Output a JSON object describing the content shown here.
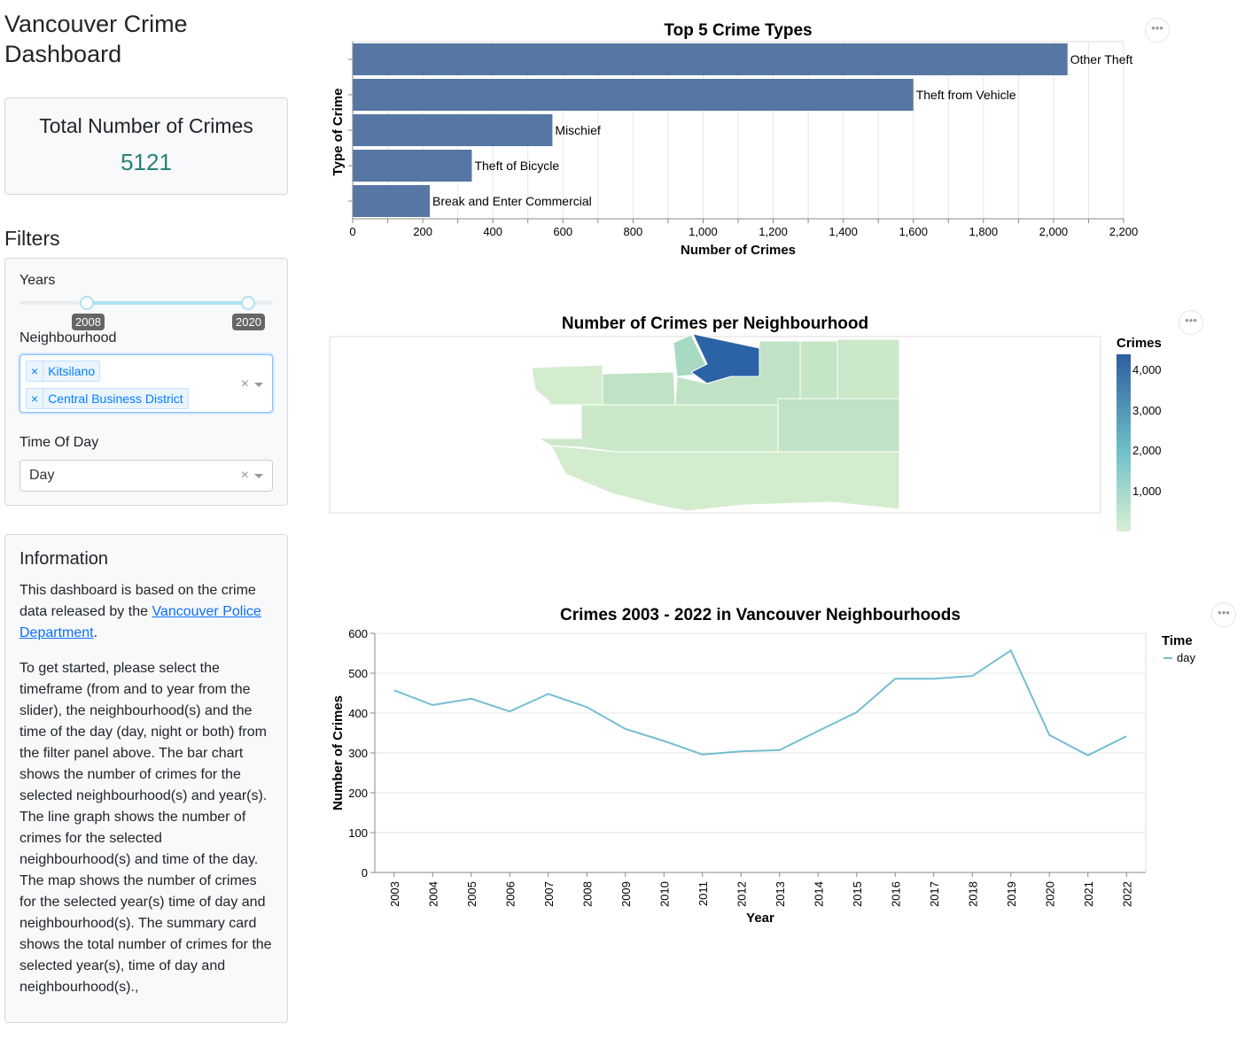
{
  "app": {
    "title_line1": "Vancouver Crime",
    "title_line2": "Dashboard"
  },
  "summary": {
    "title": "Total Number of Crimes",
    "value": "5121"
  },
  "filters": {
    "title": "Filters",
    "years_label": "Years",
    "year_from": "2008",
    "year_to": "2020",
    "neighbourhood_label": "Neighbourhood",
    "neighbourhoods_selected": [
      "Kitsilano",
      "Central Business District"
    ],
    "time_label": "Time Of Day",
    "time_value": "Day",
    "clear_glyph": "×",
    "chip_remove_glyph": "×"
  },
  "information": {
    "title": "Information",
    "p1_before": "This dashboard is based on the crime data released by the ",
    "p1_link": "Vancouver Police Department",
    "p1_after": ".",
    "p2": "To get started, please select the timeframe (from and to year from the slider), the neighbourhood(s) and the time of the day (day, night or both) from the filter panel above. The bar chart shows the number of crimes for the selected neighbourhood(s) and year(s). The line graph shows the number of crimes for the selected neighbourhood(s) and time of the day. The map shows the number of crimes for the selected year(s) time of day and neighbourhood(s). The summary card shows the total number of crimes for the selected year(s), time of day and neighbourhood(s).,"
  },
  "menu_glyph": "•••",
  "chart_data": [
    {
      "type": "bar",
      "title": "Top 5 Crime Types",
      "xlabel": "Number of Crimes",
      "ylabel": "Type of Crime",
      "categories": [
        "Other Theft",
        "Theft from Vehicle",
        "Mischief",
        "Theft of Bicycle",
        "Break and Enter Commercial"
      ],
      "values": [
        2040,
        1600,
        570,
        340,
        220
      ],
      "xlim": [
        0,
        2200
      ],
      "xticks": [
        "0",
        "200",
        "400",
        "600",
        "800",
        "1,000",
        "1,200",
        "1,400",
        "1,600",
        "1,800",
        "2,000",
        "2,200"
      ],
      "color": "#5677a4",
      "grid": true
    },
    {
      "type": "heatmap",
      "title": "Number of Crimes per Neighbourhood",
      "legend_title": "Crimes",
      "legend_ticks": [
        "4,000",
        "3,000",
        "2,000",
        "1,000"
      ],
      "color_low": "#d9f0d3",
      "color_high": "#2c5fa0",
      "regions": [
        {
          "value": 4300,
          "color": "#2c63a6"
        },
        {
          "value": 1300,
          "color": "#a8d9c2"
        },
        {
          "value": 900,
          "color": "#bfe3c4"
        },
        {
          "value": 850,
          "color": "#c4e5c6"
        },
        {
          "value": 700,
          "color": "#cbe8c8"
        },
        {
          "value": 600,
          "color": "#d4ecce"
        }
      ]
    },
    {
      "type": "line",
      "title": "Crimes 2003 - 2022 in Vancouver Neighbourhoods",
      "xlabel": "Year",
      "ylabel": "Number of Crimes",
      "ylim": [
        0,
        600
      ],
      "yticks": [
        "0",
        "100",
        "200",
        "300",
        "400",
        "500",
        "600"
      ],
      "x": [
        "2003",
        "2004",
        "2005",
        "2006",
        "2007",
        "2008",
        "2009",
        "2010",
        "2011",
        "2012",
        "2013",
        "2014",
        "2015",
        "2016",
        "2017",
        "2018",
        "2019",
        "2020",
        "2021",
        "2022"
      ],
      "series": [
        {
          "name": "day",
          "values": [
            457,
            420,
            436,
            404,
            448,
            415,
            360,
            330,
            296,
            304,
            307,
            355,
            402,
            486,
            486,
            493,
            557,
            345,
            294,
            342
          ],
          "color": "#74bed0"
        }
      ],
      "legend_title": "Time",
      "grid": true
    }
  ]
}
